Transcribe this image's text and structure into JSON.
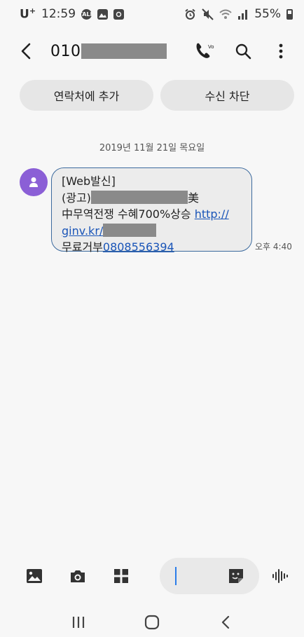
{
  "status_bar": {
    "carrier": "U",
    "carrier_sup": "+",
    "time": "12:59",
    "notif_icons": [
      "talk-icon",
      "gallery-icon",
      "record-icon"
    ],
    "system_icons": [
      "alarm-icon",
      "mute-icon",
      "wifi-icon",
      "signal-icon"
    ],
    "battery": "55%"
  },
  "header": {
    "phone_number_prefix": "010",
    "call_icon_label": "Vo LTE",
    "icons": [
      "back-icon",
      "call-icon",
      "search-icon",
      "more-icon"
    ]
  },
  "actions": {
    "add_contact": "연락처에 추가",
    "block": "수신 차단"
  },
  "conversation": {
    "date": "2019년 11월 21일 목요일",
    "message": {
      "line1": "[Web발신]",
      "line2_prefix": "(광고)",
      "line2_suffix": "美",
      "line3_text": "中무역전쟁 수혜700%상승 ",
      "line3_link": "http://",
      "line4_link": "ginv.kr/",
      "line5_text": "무료거부",
      "line5_phone": "0808556394"
    },
    "time": "오후 4:40"
  },
  "composer": {
    "icons": [
      "image-icon",
      "camera-icon",
      "apps-icon",
      "sticker-icon",
      "voice-icon"
    ]
  },
  "nav": {
    "icons": [
      "recents-icon",
      "home-icon",
      "back-nav-icon"
    ]
  },
  "colors": {
    "avatar": "#8b5fd6",
    "bubble_border": "#3c6a9e",
    "link": "#1a55b8",
    "caret": "#2b7de9",
    "redaction": "#8a8a8a"
  }
}
